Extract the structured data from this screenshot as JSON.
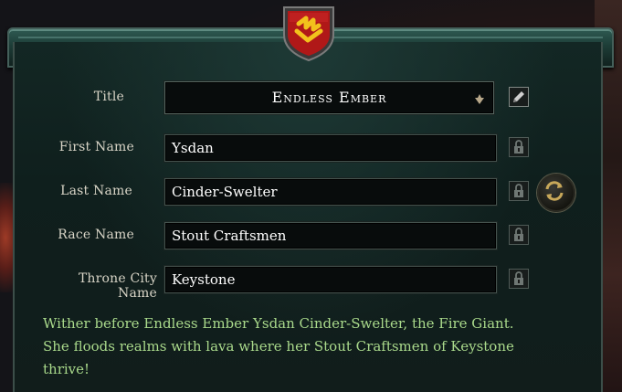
{
  "fields": [
    {
      "label": "Title",
      "value": "Endless Ember",
      "kind": "select"
    },
    {
      "label": "First Name",
      "value": "Ysdan",
      "kind": "text"
    },
    {
      "label": "Last Name",
      "value": "Cinder-Swelter",
      "kind": "text"
    },
    {
      "label": "Race Name",
      "value": "Stout Craftsmen",
      "kind": "text"
    },
    {
      "label": "Throne City Name",
      "value": "Keystone",
      "kind": "text"
    }
  ],
  "description": "Wither before Endless Ember Ysdan Cinder-Swelter, the Fire Giant. She floods realms with lava where her Stout Craftsmen of Keystone thrive!",
  "icons": {
    "crest": "fire-crest-icon",
    "dropdown": "chevron-down-icon",
    "edit": "pencil-icon",
    "lock": "lock-icon",
    "reroll": "refresh-icon"
  },
  "colors": {
    "panel": "#132724",
    "description_text": "#a9d98b",
    "crest_red": "#b01818",
    "crest_gold": "#f2c21c"
  }
}
